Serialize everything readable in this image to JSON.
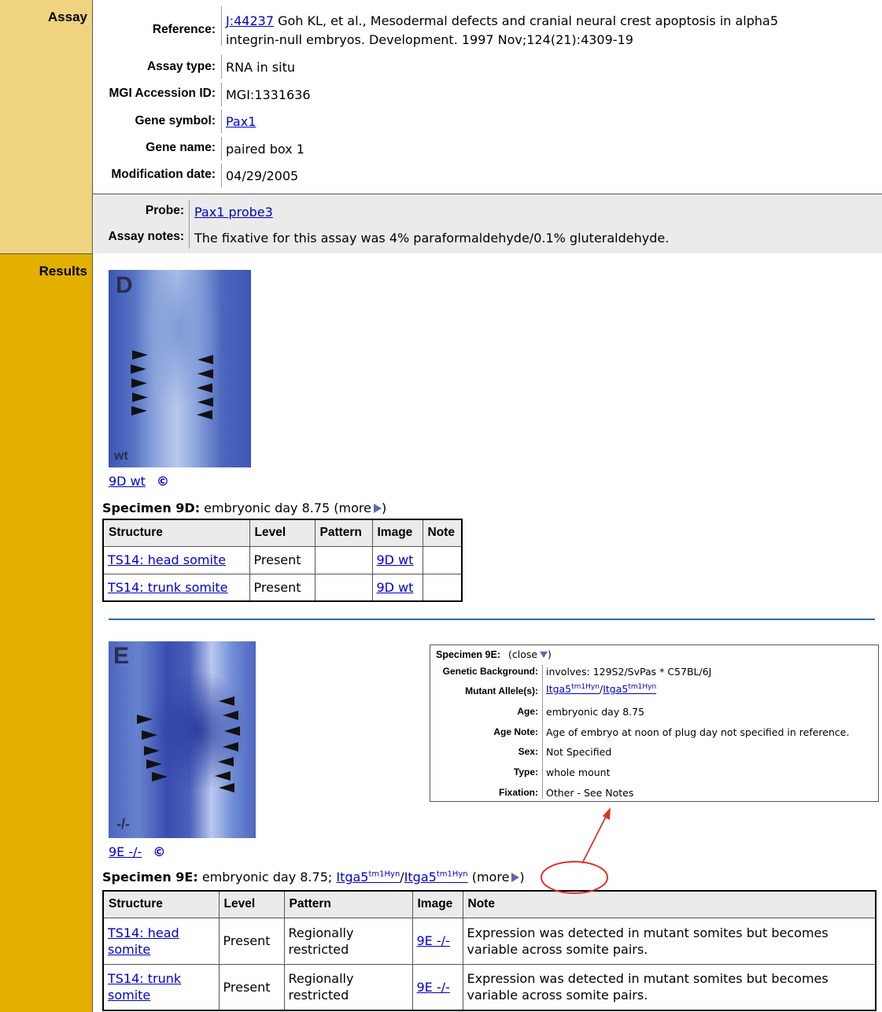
{
  "sections": {
    "assay": "Assay",
    "results": "Results"
  },
  "assay": {
    "reference_label": "Reference:",
    "reference_link": "J:44237",
    "reference_text_1": " Goh KL, et al., Mesodermal defects and cranial neural crest apoptosis in alpha5",
    "reference_text_2": "integrin-null embryos. Development. 1997 Nov;124(21):4309-19",
    "assay_type_label": "Assay type:",
    "assay_type": "RNA in situ",
    "accession_label": "MGI Accession ID:",
    "accession": "MGI:1331636",
    "gene_symbol_label": "Gene symbol:",
    "gene_symbol": "Pax1",
    "gene_name_label": "Gene name:",
    "gene_name": "paired box 1",
    "mod_date_label": "Modification date:",
    "mod_date": "04/29/2005",
    "probe_label": "Probe:",
    "probe": "Pax1 probe3",
    "notes_label": "Assay notes:",
    "notes": "The fixative for this assay was 4% paraformaldehyde/0.1% gluteraldehyde."
  },
  "specimen_d": {
    "image_letter": "D",
    "image_foot": "wt",
    "caption_link": "9D wt",
    "copyright": "©",
    "heading_bold": "Specimen 9D:",
    "heading_text": " embryonic day 8.75 (",
    "more": "more",
    "heading_close": ")",
    "columns": [
      "Structure",
      "Level",
      "Pattern",
      "Image",
      "Note"
    ],
    "rows": [
      {
        "structure": "TS14: head somite",
        "level": "Present",
        "pattern": "",
        "image": "9D wt",
        "note": ""
      },
      {
        "structure": "TS14: trunk somite",
        "level": "Present",
        "pattern": "",
        "image": "9D wt",
        "note": ""
      }
    ]
  },
  "specimen_e": {
    "image_letter": "E",
    "image_foot": "-/-",
    "caption_link": "9E -/-",
    "copyright": "©",
    "heading_bold": "Specimen 9E:",
    "heading_text": " embryonic day 8.75; ",
    "allele_base": "Itga5",
    "allele_sup": "tm1Hyn",
    "slash": "/",
    "more": "more",
    "heading_open": " (",
    "heading_close": ")",
    "columns": [
      "Structure",
      "Level",
      "Pattern",
      "Image",
      "Note"
    ],
    "rows": [
      {
        "structure_1": "TS14: head",
        "structure_2": "somite",
        "level": "Present",
        "pattern_1": "Regionally",
        "pattern_2": "restricted",
        "image": "9E -/-",
        "note_1": "Expression was detected in mutant somites but becomes",
        "note_2": "variable across somite pairs."
      },
      {
        "structure_1": "TS14: trunk",
        "structure_2": "somite",
        "level": "Present",
        "pattern_1": "Regionally",
        "pattern_2": "restricted",
        "image": "9E -/-",
        "note_1": "Expression was detected in mutant somites but becomes",
        "note_2": "variable across somite pairs."
      }
    ]
  },
  "popup": {
    "title_bold": "Specimen 9E:",
    "close": "(close",
    "close_end": ")",
    "genetic_bg_label": "Genetic Background:",
    "genetic_bg": "involves: 129S2/SvPas * C57BL/6J",
    "mutant_label": "Mutant Allele(s):",
    "allele_base": "Itga5",
    "allele_sup": "tm1Hyn",
    "slash": "/",
    "age_label": "Age:",
    "age": "embryonic day 8.75",
    "age_note_label": "Age Note:",
    "age_note": "Age of embryo at noon of plug day not specified in reference.",
    "sex_label": "Sex:",
    "sex": "Not Specified",
    "type_label": "Type:",
    "type": "whole mount",
    "fixation_label": "Fixation:",
    "fixation": "Other - See Notes"
  },
  "colors": {
    "assay_side": "#f0d37f",
    "results_side": "#e3b000",
    "link": "#0000cc",
    "divider": "#2b6ca5",
    "annotation": "#e0322a"
  }
}
